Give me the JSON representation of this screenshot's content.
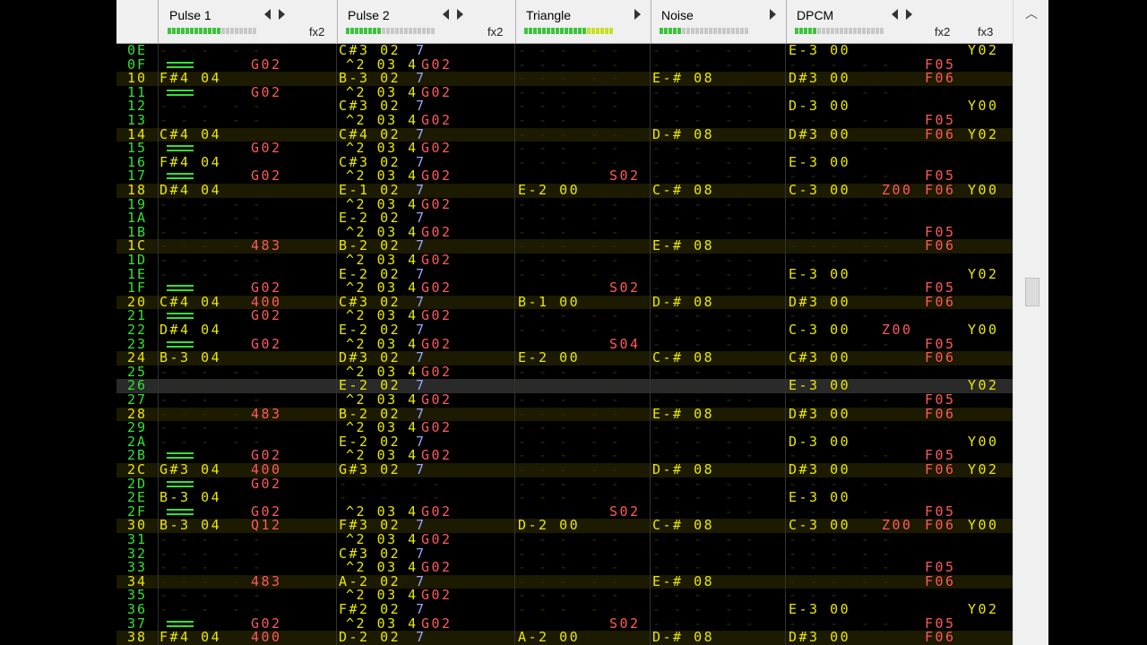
{
  "header": {
    "channels": [
      {
        "name": "Pulse 1",
        "fx": "fx2",
        "vol_on": 12,
        "vol_total": 20
      },
      {
        "name": "Pulse 2",
        "fx": "fx2",
        "vol_on": 8,
        "vol_total": 20
      },
      {
        "name": "Triangle",
        "fx": "",
        "vol_on": 20,
        "vol_total": 20
      },
      {
        "name": "Noise",
        "fx": "",
        "vol_on": 5,
        "vol_total": 20
      },
      {
        "name": "DPCM",
        "fx": "fx2",
        "fx3": "fx3",
        "vol_on": 5,
        "vol_total": 20
      }
    ]
  },
  "rows": [
    {
      "n": "0E",
      "p1": "",
      "p2": "C#3 02 7",
      "tri": "",
      "noi": "",
      "dp": "E-3 00",
      "dpfx": "Y02"
    },
    {
      "n": "0F",
      "p1": "REL",
      "p1fx": "G02",
      "p2": "^2 03 4 G02",
      "tri": "",
      "noi": "",
      "dp": "",
      "dpfx": "F05"
    },
    {
      "n": "10",
      "p1": "F#4 04",
      "p2": "B-3 02 7",
      "tri": "",
      "noi": "E-# 08 6",
      "dp": "D#3 00",
      "dpfx": "F06"
    },
    {
      "n": "11",
      "p1": "REL",
      "p1fx": "G02",
      "p2": "^2 03 4 G02",
      "tri": "",
      "noi": "",
      "dp": "",
      "dpfx": ""
    },
    {
      "n": "12",
      "p1": "",
      "p2": "C#3 02 7",
      "tri": "",
      "noi": "",
      "dp": "D-3 00",
      "dpfx": "Y00"
    },
    {
      "n": "13",
      "p1": "",
      "p2": "^2 03 4 G02",
      "tri": "",
      "noi": "",
      "dp": "",
      "dpfx": "F05"
    },
    {
      "n": "14",
      "p1": "C#4 04",
      "p2": "C#4 02 7",
      "tri": "",
      "noi": "D-# 08 6",
      "dp": "D#3 00",
      "dpfx": "F06 Y02"
    },
    {
      "n": "15",
      "p1": "REL",
      "p1fx": "G02",
      "p2": "^2 03 4 G02",
      "tri": "",
      "noi": "",
      "dp": "",
      "dpfx": ""
    },
    {
      "n": "16",
      "p1": "F#4 04",
      "p2": "C#3 02 7",
      "tri": "",
      "noi": "",
      "dp": "E-3 00",
      "dpfx": ""
    },
    {
      "n": "17",
      "p1": "REL",
      "p1fx": "G02",
      "p2": "^2 03 4 G02",
      "tri": "S02",
      "noi": "",
      "dp": "",
      "dpfx": "F05"
    },
    {
      "n": "18",
      "p1": "D#4 04",
      "p2": "E-1 02 7",
      "tri": "E-2 00",
      "noi": "C-# 08 7",
      "dp": "C-3 00",
      "dpfx": "Z00 F06 Y00"
    },
    {
      "n": "19",
      "p1": "",
      "p2": "^2 03 4 G02",
      "tri": "",
      "noi": "",
      "dp": "",
      "dpfx": ""
    },
    {
      "n": "1A",
      "p1": "",
      "p2": "E-2 02 7",
      "tri": "",
      "noi": "",
      "dp": "",
      "dpfx": ""
    },
    {
      "n": "1B",
      "p1": "",
      "p2": "^2 03 4 G02",
      "tri": "",
      "noi": "",
      "dp": "",
      "dpfx": "F05"
    },
    {
      "n": "1C",
      "p1": "",
      "p1fx": "483",
      "p2": "B-2 02 7",
      "tri": "",
      "noi": "E-# 08 7",
      "dp": "",
      "dpfx": "F06"
    },
    {
      "n": "1D",
      "p1": "",
      "p2": "^2 03 4 G02",
      "tri": "",
      "noi": "",
      "dp": "",
      "dpfx": ""
    },
    {
      "n": "1E",
      "p1": "",
      "p2": "E-2 02 7",
      "tri": "",
      "noi": "",
      "dp": "E-3 00",
      "dpfx": "Y02"
    },
    {
      "n": "1F",
      "p1": "REL",
      "p1fx": "G02",
      "p2": "^2 03 4 G02",
      "tri": "S02",
      "noi": "",
      "dp": "",
      "dpfx": "F05"
    },
    {
      "n": "20",
      "p1": "C#4 04",
      "p1fx": "400",
      "p2": "C#3 02 7",
      "tri": "B-1 00",
      "noi": "D-# 08 6",
      "dp": "D#3 00",
      "dpfx": "F06"
    },
    {
      "n": "21",
      "p1": "REL",
      "p1fx": "G02",
      "p2": "^2 03 4 G02",
      "tri": "",
      "noi": "",
      "dp": "",
      "dpfx": ""
    },
    {
      "n": "22",
      "p1": "D#4 04",
      "p2": "E-2 02 7",
      "tri": "",
      "noi": "",
      "dp": "C-3 00",
      "dpfx": "Z00 Y00"
    },
    {
      "n": "23",
      "p1": "REL",
      "p1fx": "G02",
      "p2": "^2 03 4 G02",
      "tri": "S04",
      "noi": "",
      "dp": "",
      "dpfx": "F05"
    },
    {
      "n": "24",
      "p1": "B-3 04",
      "p2": "D#3 02 7",
      "tri": "E-2 00",
      "noi": "C-# 08 8",
      "dp": "C#3 00",
      "dpfx": "F06"
    },
    {
      "n": "25",
      "p1": "",
      "p2": "^2 03 4 G02",
      "tri": "",
      "noi": "",
      "dp": "",
      "dpfx": ""
    },
    {
      "n": "26",
      "p1": "",
      "p2": "E-2 02 7",
      "tri": "",
      "noi": "",
      "dp": "E-3 00",
      "dpfx": "Y02"
    },
    {
      "n": "27",
      "p1": "",
      "p2": "^2 03 4 G02",
      "tri": "",
      "noi": "",
      "dp": "",
      "dpfx": "F05"
    },
    {
      "n": "28",
      "p1": "",
      "p1fx": "483",
      "p2": "B-2 02 7",
      "tri": "",
      "noi": "E-# 08 6",
      "dp": "D#3 00",
      "dpfx": "F06"
    },
    {
      "n": "29",
      "p1": "",
      "p2": "^2 03 4 G02",
      "tri": "",
      "noi": "",
      "dp": "",
      "dpfx": ""
    },
    {
      "n": "2A",
      "p1": "",
      "p2": "E-2 02 7",
      "tri": "",
      "noi": "",
      "dp": "D-3 00",
      "dpfx": "Y00"
    },
    {
      "n": "2B",
      "p1": "REL",
      "p1fx": "G02",
      "p2": "^2 03 4 G02",
      "tri": "",
      "noi": "",
      "dp": "",
      "dpfx": "F05"
    },
    {
      "n": "2C",
      "p1": "G#3 04",
      "p1fx": "400",
      "p2": "G#3 02 7",
      "tri": "",
      "noi": "D-# 08 6",
      "dp": "D#3 00",
      "dpfx": "F06 Y02"
    },
    {
      "n": "2D",
      "p1": "REL",
      "p1fx": "G02",
      "p2": "",
      "tri": "",
      "noi": "",
      "dp": "",
      "dpfx": ""
    },
    {
      "n": "2E",
      "p1": "B-3 04",
      "p2": "",
      "tri": "",
      "noi": "",
      "dp": "E-3 00",
      "dpfx": ""
    },
    {
      "n": "2F",
      "p1": "REL",
      "p1fx": "G02",
      "p2": "^2 03 4 G02",
      "tri": "S02",
      "noi": "",
      "dp": "",
      "dpfx": "F05"
    },
    {
      "n": "30",
      "p1": "B-3 04",
      "p1fx": "Q12",
      "p2": "F#3 02 7",
      "tri": "D-2 00",
      "noi": "C-# 08 7",
      "dp": "C-3 00",
      "dpfx": "Z00 F06 Y00"
    },
    {
      "n": "31",
      "p1": "",
      "p2": "^2 03 4 G02",
      "tri": "",
      "noi": "",
      "dp": "",
      "dpfx": ""
    },
    {
      "n": "32",
      "p1": "",
      "p2": "C#3 02 7",
      "tri": "",
      "noi": "",
      "dp": "",
      "dpfx": ""
    },
    {
      "n": "33",
      "p1": "",
      "p2": "^2 03 4 G02",
      "tri": "",
      "noi": "",
      "dp": "",
      "dpfx": "F05"
    },
    {
      "n": "34",
      "p1": "",
      "p1fx": "483",
      "p2": "A-2 02 7",
      "tri": "",
      "noi": "E-# 08 7",
      "dp": "",
      "dpfx": "F06"
    },
    {
      "n": "35",
      "p1": "",
      "p2": "^2 03 4 G02",
      "tri": "",
      "noi": "",
      "dp": "",
      "dpfx": ""
    },
    {
      "n": "36",
      "p1": "",
      "p2": "F#2 02 7",
      "tri": "",
      "noi": "",
      "dp": "E-3 00",
      "dpfx": "Y02"
    },
    {
      "n": "37",
      "p1": "REL",
      "p1fx": "G02",
      "p2": "^2 03 4 G02",
      "tri": "S02",
      "noi": "",
      "dp": "",
      "dpfx": "F05"
    },
    {
      "n": "38",
      "p1": "F#4 04",
      "p1fx": "400",
      "p2": "D-2 02 7",
      "tri": "A-2 00",
      "noi": "D-# 08 6",
      "dp": "D#3 00",
      "dpfx": "F06"
    }
  ],
  "colors": {
    "note": "#e8e800",
    "rownum": "#33e233",
    "effect": "#ff5a5a",
    "volume": "#9aa8ff"
  }
}
